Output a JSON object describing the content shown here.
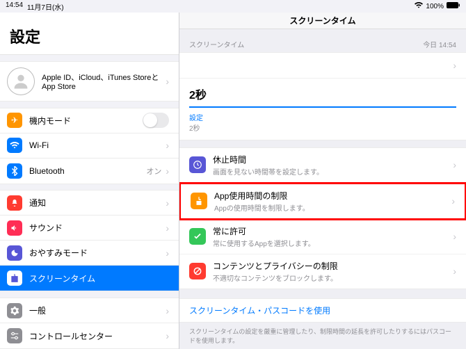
{
  "status": {
    "time": "14:54",
    "date": "11月7日(水)",
    "battery": "100%"
  },
  "sidebar": {
    "title": "設定",
    "appleid": "Apple ID、iCloud、iTunes StoreとApp Store",
    "airplane": "機内モード",
    "wifi": "Wi-Fi",
    "bluetooth": "Bluetooth",
    "bluetooth_val": "オン",
    "notify": "通知",
    "sound": "サウンド",
    "dnd": "おやすみモード",
    "screentime": "スクリーンタイム",
    "general": "一般",
    "control": "コントロールセンター"
  },
  "detail": {
    "title": "スクリーンタイム",
    "section_label": "スクリーンタイム",
    "section_time": "今日 14:54",
    "duration": "2秒",
    "setting_label": "設定",
    "setting_val": "2秒",
    "downtime_t": "休止時間",
    "downtime_s": "画面を見ない時間帯を設定します。",
    "applimit_t": "App使用時間の制限",
    "applimit_s": "Appの使用時間を制限します。",
    "allow_t": "常に許可",
    "allow_s": "常に使用するAppを選択します。",
    "content_t": "コンテンツとプライバシーの制限",
    "content_s": "不適切なコンテンツをブロックします。",
    "passcode": "スクリーンタイム・パスコードを使用",
    "footnote": "スクリーンタイムの設定を厳重に管理したり、制限時間の延長を許可したりするにはパスコードを使用します。"
  }
}
